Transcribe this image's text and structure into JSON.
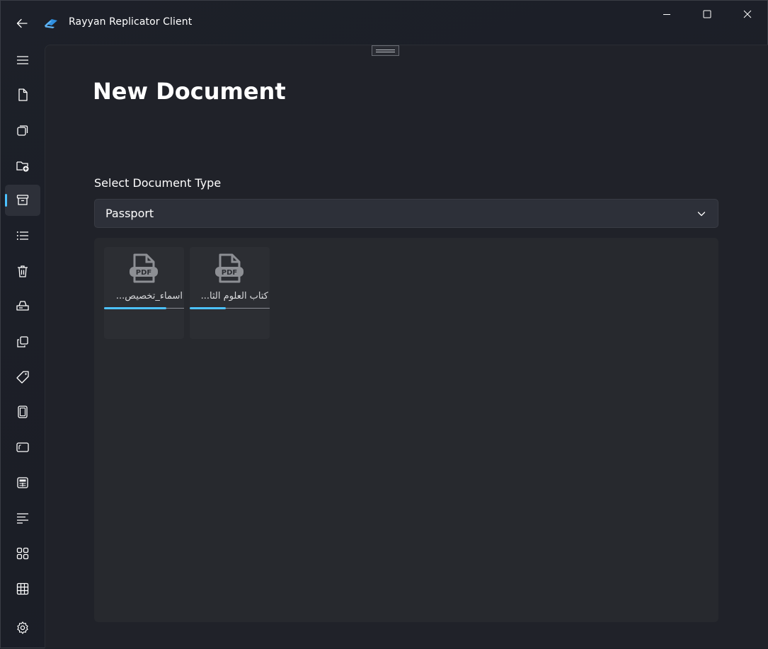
{
  "app": {
    "title": "Rayyan Replicator Client",
    "accent_color": "#4cc2ff"
  },
  "sidebar": {
    "selected_index": 4,
    "items": [
      {
        "icon": "hamburger-menu-icon"
      },
      {
        "icon": "document-icon"
      },
      {
        "icon": "copies-icon"
      },
      {
        "icon": "folder-add-icon"
      },
      {
        "icon": "archive-icon"
      },
      {
        "icon": "bulleted-list-icon"
      },
      {
        "icon": "trash-icon"
      },
      {
        "icon": "scanner-icon"
      },
      {
        "icon": "duplicate-icon"
      },
      {
        "icon": "tag-icon"
      },
      {
        "icon": "tablet-icon"
      },
      {
        "icon": "screen-icon"
      },
      {
        "icon": "calendar-table-icon"
      },
      {
        "icon": "text-align-left-icon"
      },
      {
        "icon": "apps-grid-icon"
      },
      {
        "icon": "table-grid-icon"
      },
      {
        "icon": "settings-icon"
      }
    ]
  },
  "main": {
    "page_title": "New Document",
    "document_type_label": "Select Document Type",
    "document_type_value": "Passport",
    "files": [
      {
        "name": "اسماء_تخصيص...",
        "icon": "pdf-file-icon",
        "progress": 0.78
      },
      {
        "name": "كتاب العلوم الثا...",
        "icon": "pdf-file-icon",
        "progress": 0.45
      }
    ]
  }
}
